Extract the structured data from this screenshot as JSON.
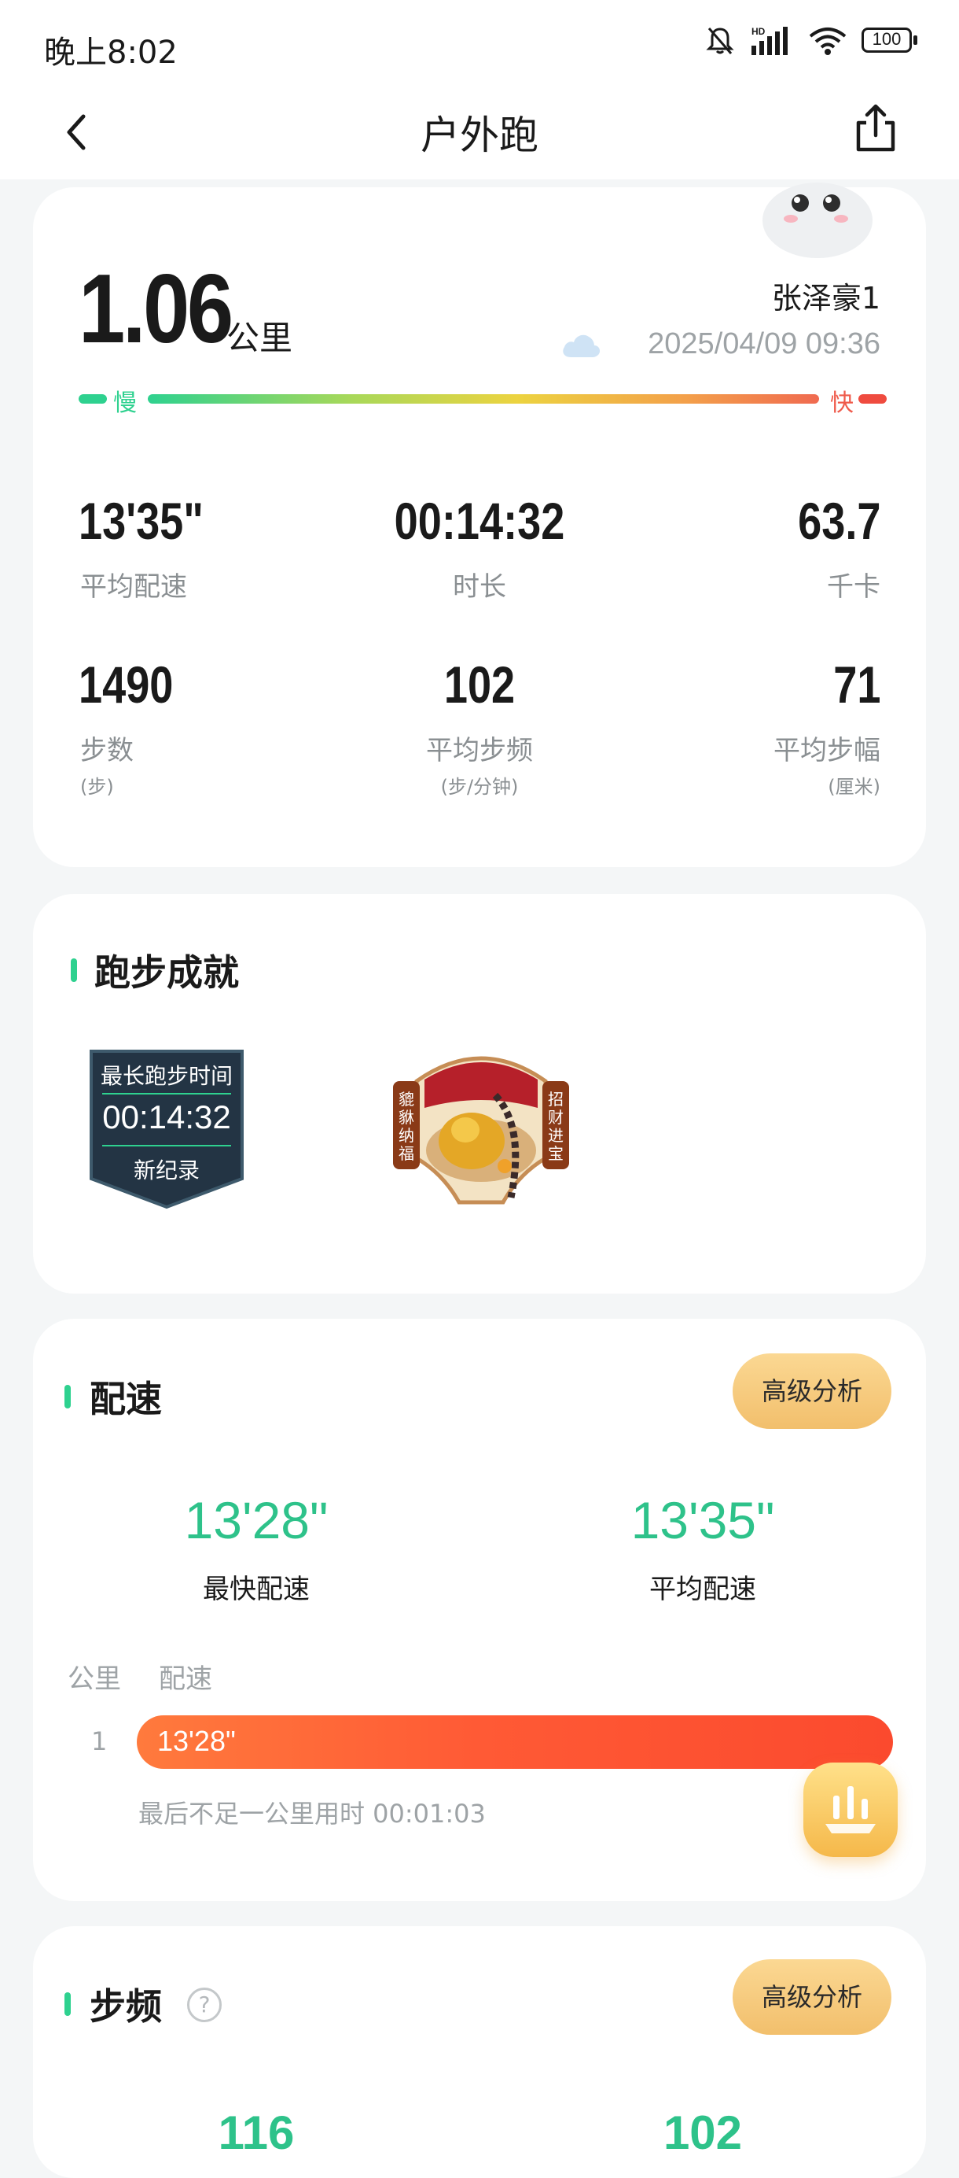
{
  "status_bar": {
    "time": "晚上8:02",
    "battery": "100",
    "signal_label": "HD"
  },
  "header": {
    "title": "户外跑"
  },
  "summary": {
    "distance": "1.06",
    "distance_unit": "公里",
    "user": "张泽豪1",
    "datetime": "2025/04/09 09:36",
    "pace_scale": {
      "slow": "慢",
      "fast": "快"
    },
    "stats": [
      {
        "value": "13'35\"",
        "label": "平均配速",
        "unit": ""
      },
      {
        "value": "00:14:32",
        "label": "时长",
        "unit": ""
      },
      {
        "value": "63.7",
        "label": "千卡",
        "unit": ""
      },
      {
        "value": "1490",
        "label": "步数",
        "unit": "(步)"
      },
      {
        "value": "102",
        "label": "平均步频",
        "unit": "(步/分钟)"
      },
      {
        "value": "71",
        "label": "平均步幅",
        "unit": "(厘米)"
      }
    ]
  },
  "achievements": {
    "title": "跑步成就",
    "badges": [
      {
        "top": "最长跑步时间",
        "value": "00:14:32",
        "bottom": "新纪录"
      },
      {
        "left": "貔貅纳福",
        "right": "招财进宝"
      }
    ]
  },
  "pace": {
    "title": "配速",
    "advanced_button": "高级分析",
    "fastest": {
      "value": "13'28\"",
      "label": "最快配速"
    },
    "average": {
      "value": "13'35\"",
      "label": "平均配速"
    },
    "table_headers": {
      "km": "公里",
      "pace": "配速"
    },
    "rows": [
      {
        "km": "1",
        "pace": "13'28\""
      }
    ],
    "note": "最后不足一公里用时 00:01:03"
  },
  "cadence": {
    "title": "步频",
    "help": "?",
    "advanced_button": "高级分析",
    "max_value": "116",
    "avg_value": "102"
  },
  "colors": {
    "accent_green": "#2ed18f",
    "pace_bar": "#ff5a35",
    "button_gold": "#f2bf6c"
  }
}
